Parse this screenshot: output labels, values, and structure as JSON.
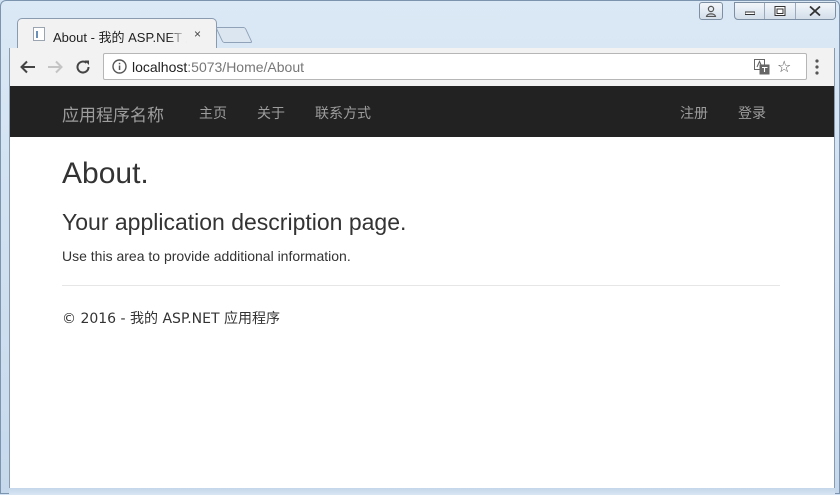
{
  "browser": {
    "tab_title": "About - 我的 ASP.NET 应用程序",
    "tab_close": "×",
    "url_host": "localhost",
    "url_rest": ":5073/Home/About",
    "icons": [
      "user-icon",
      "minimize-icon",
      "maximize-icon",
      "close-icon",
      "back-icon",
      "forward-icon",
      "reload-icon",
      "info-icon",
      "translate-icon",
      "star-icon",
      "menu-icon"
    ]
  },
  "navbar": {
    "brand": "应用程序名称",
    "links": [
      "主页",
      "关于",
      "联系方式"
    ],
    "right_links": [
      "注册",
      "登录"
    ]
  },
  "page": {
    "heading": "About.",
    "subheading": "Your application description page.",
    "paragraph": "Use this area to provide additional information.",
    "footer": "© 2016 - 我的 ASP.NET 应用程序"
  },
  "colors": {
    "navbar_bg": "#222222",
    "nav_text": "#9d9d9d",
    "body_text": "#333333"
  }
}
